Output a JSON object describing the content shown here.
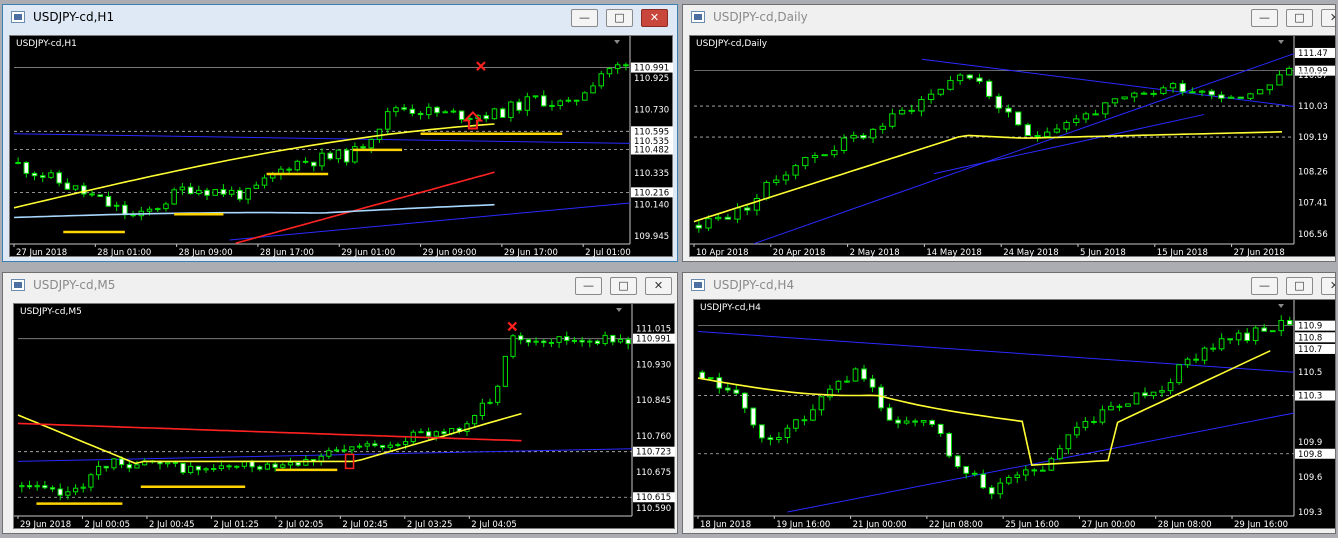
{
  "windows": [
    {
      "key": "h1",
      "title": "USDJPY-cd,H1",
      "chart_label": "USDJPY-cd,H1",
      "active": true
    },
    {
      "key": "daily",
      "title": "USDJPY-cd,Daily",
      "chart_label": "USDJPY-cd,Daily",
      "active": false
    },
    {
      "key": "m5",
      "title": "USDJPY-cd,M5",
      "chart_label": "USDJPY-cd,M5",
      "active": false
    },
    {
      "key": "h4",
      "title": "USDJPY-cd,H4",
      "chart_label": "USDJPY-cd,H4",
      "active": false
    }
  ],
  "window_controls": {
    "minimize": "—",
    "maximize": "□",
    "close": "✕"
  },
  "chart_data": [
    {
      "type": "candlestick",
      "window": "h1",
      "ylim": [
        109.92,
        111.1
      ],
      "x_ticks": [
        "27 Jun 2018",
        "28 Jun 01:00",
        "28 Jun 09:00",
        "28 Jun 17:00",
        "29 Jun 01:00",
        "29 Jun 09:00",
        "29 Jun 17:00",
        "2 Jul 01:00"
      ],
      "price_ticks": [
        "110.991",
        "110.925",
        "110.730",
        "110.595",
        "110.535",
        "110.482",
        "110.335",
        "110.216",
        "110.140",
        "109.945"
      ],
      "current_price": 110.991,
      "annotations": [
        "red X at last high",
        "red up arrow",
        "yellow support marks"
      ],
      "colors": {
        "bull": "#00ff00",
        "bear": "#00ff00",
        "ma_fast": "#ffff33",
        "ma_mid": "#ff2222",
        "ma_slow": "#a8d8ff",
        "trend": "#2a2aff",
        "mark": "#ffd400"
      }
    },
    {
      "type": "candlestick",
      "window": "daily",
      "ylim": [
        106.4,
        111.55
      ],
      "x_ticks": [
        "10 Apr 2018",
        "20 Apr 2018",
        "2 May 2018",
        "14 May 2018",
        "24 May 2018",
        "5 Jun 2018",
        "15 Jun 2018",
        "27 Jun 2018"
      ],
      "price_ticks": [
        "111.47",
        "110.99",
        "110.87",
        "110.03",
        "109.19",
        "108.26",
        "107.41",
        "106.56"
      ],
      "current_price": 110.99
    },
    {
      "type": "candlestick",
      "window": "m5",
      "ylim": [
        110.58,
        111.04
      ],
      "x_ticks": [
        "29 Jun 2018",
        "2 Jul 00:05",
        "2 Jul 00:45",
        "2 Jul 01:25",
        "2 Jul 02:05",
        "2 Jul 02:45",
        "2 Jul 03:25",
        "2 Jul 04:05"
      ],
      "price_ticks": [
        "111.015",
        "110.991",
        "110.930",
        "110.845",
        "110.760",
        "110.723",
        "110.675",
        "110.615",
        "110.590"
      ],
      "current_price": 110.991
    },
    {
      "type": "candlestick",
      "window": "h4",
      "ylim": [
        109.3,
        111.0
      ],
      "x_ticks": [
        "18 Jun 2018",
        "19 Jun 16:00",
        "21 Jun 00:00",
        "22 Jun 08:00",
        "25 Jun 16:00",
        "27 Jun 00:00",
        "28 Jun 08:00",
        "29 Jun 16:00"
      ],
      "price_ticks": [
        "110.9",
        "110.8",
        "110.7",
        "110.5",
        "110.3",
        "109.9",
        "109.8",
        "109.6",
        "109.3"
      ],
      "current_price": 110.9
    }
  ]
}
